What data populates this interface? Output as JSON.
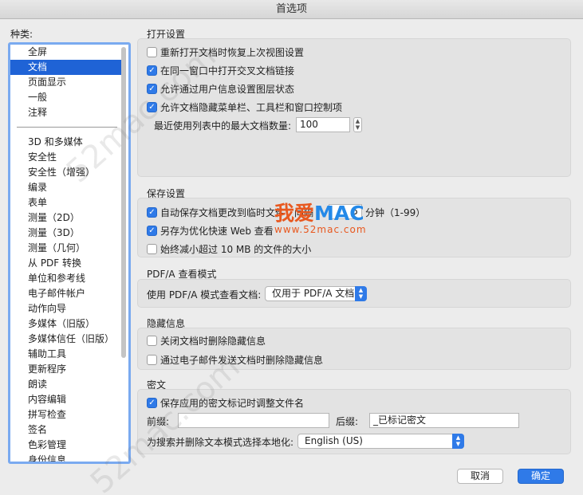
{
  "window": {
    "title": "首选项"
  },
  "sidebar": {
    "label": "种类:",
    "items": [
      "全屏",
      "文档",
      "页面显示",
      "一般",
      "注释",
      "3D 和多媒体",
      "安全性",
      "安全性（增强）",
      "编录",
      "表单",
      "测量（2D）",
      "测量（3D）",
      "测量（几何）",
      "从 PDF 转换",
      "单位和参考线",
      "电子邮件帐户",
      "动作向导",
      "多媒体（旧版）",
      "多媒体信任（旧版）",
      "辅助工具",
      "更新程序",
      "朗读",
      "内容编辑",
      "拼写检查",
      "签名",
      "色彩管理",
      "身份信息"
    ]
  },
  "open": {
    "title": "打开设置",
    "restore_view": "重新打开文档时恢复上次视图设置",
    "same_window": "在同一窗口中打开交叉文档链接",
    "layer_state": "允许通过用户信息设置图层状态",
    "hide_ui": "允许文档隐藏菜单栏、工具栏和窗口控制项",
    "max_docs_label": "最近使用列表中的最大文档数量:",
    "max_docs_value": "100"
  },
  "save": {
    "title": "保存设置",
    "autosave_prefix": "自动保存文档更改到临时文件，间隔",
    "autosave_value": "5",
    "autosave_suffix": "分钟（1-99）",
    "fast_web": "另存为优化快速 Web 查看",
    "reduce_size": "始终减小超过 10 MB 的文件的大小"
  },
  "pdfa": {
    "title": "PDF/A 查看模式",
    "label": "使用 PDF/A 模式查看文档:",
    "value": "仅用于 PDF/A 文档"
  },
  "hidden": {
    "title": "隐藏信息",
    "on_close": "关闭文档时删除隐藏信息",
    "on_email": "通过电子邮件发送文档时删除隐藏信息"
  },
  "redact": {
    "title": "密文",
    "adjust_name": "保存应用的密文标记时调整文件名",
    "prefix_label": "前缀:",
    "prefix_value": "",
    "suffix_label": "后缀:",
    "suffix_value": "_已标记密文",
    "locale_label": "为搜索并删除文本模式选择本地化:",
    "locale_value": "English (US)"
  },
  "buttons": {
    "cancel": "取消",
    "ok": "确定"
  },
  "watermark": {
    "logo_a": "我爱",
    "logo_b": "MAC",
    "url": "www.52mac.com",
    "diag_a": "52mac.com",
    "diag_b": "52mac.com"
  }
}
